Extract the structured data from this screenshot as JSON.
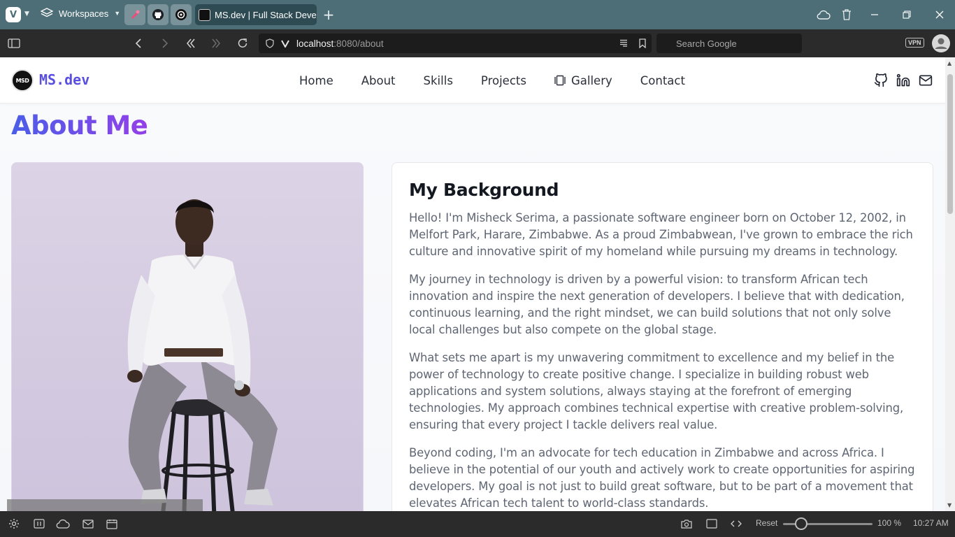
{
  "browser": {
    "workspaces_label": "Workspaces",
    "active_tab_title": "MS.dev | Full Stack Developer",
    "url_host": "localhost",
    "url_path": ":8080/about",
    "search_placeholder": "Search Google",
    "vpn_label": "VPN"
  },
  "site": {
    "logo_text": "MSD",
    "brand": "MS.dev",
    "nav": {
      "home": "Home",
      "about": "About",
      "skills": "Skills",
      "projects": "Projects",
      "gallery": "Gallery",
      "contact": "Contact"
    },
    "page_title": "About Me",
    "background": {
      "heading": "My Background",
      "paragraphs": [
        "Hello! I'm Misheck Serima, a passionate software engineer born on October 12, 2002, in Melfort Park, Harare, Zimbabwe. As a proud Zimbabwean, I've grown to embrace the rich culture and innovative spirit of my homeland while pursuing my dreams in technology.",
        "My journey in technology is driven by a powerful vision: to transform African tech innovation and inspire the next generation of developers. I believe that with dedication, continuous learning, and the right mindset, we can build solutions that not only solve local challenges but also compete on the global stage.",
        "What sets me apart is my unwavering commitment to excellence and my belief in the power of technology to create positive change. I specialize in building robust web applications and system solutions, always staying at the forefront of emerging technologies. My approach combines technical expertise with creative problem-solving, ensuring that every project I tackle delivers real value.",
        "Beyond coding, I'm an advocate for tech education in Zimbabwe and across Africa. I believe in the potential of our youth and actively work to create opportunities for aspiring developers. My goal is not just to build great software, but to be part of a movement that elevates African tech talent to world-class standards."
      ]
    }
  },
  "statusbar": {
    "reset_label": "Reset",
    "zoom_level": "100 %",
    "clock": "10:27 AM"
  }
}
